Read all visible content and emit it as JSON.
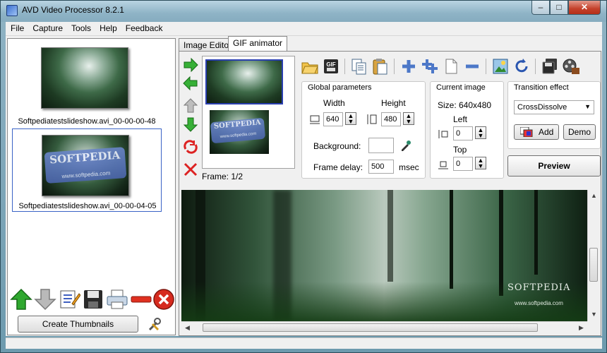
{
  "window": {
    "title": "AVD Video Processor 8.2.1"
  },
  "menu": [
    "File",
    "Capture",
    "Tools",
    "Help",
    "Feedback"
  ],
  "thumbnails": [
    {
      "label": "Softpediatestslideshow.avi_00-00-00-48"
    },
    {
      "label": "Softpediatestslideshow.avi_00-00-04-05",
      "banner": "SOFTPEDIA",
      "banner_sub": "www.softpedia.com"
    }
  ],
  "left_panel": {
    "create_thumbnails_label": "Create Thumbnails"
  },
  "tabs": [
    {
      "label": "Image Editor"
    },
    {
      "label": "GIF animator"
    }
  ],
  "frames": {
    "frame_label": "Frame: 1/2",
    "frame2_banner": "SOFTPEDIA",
    "frame2_sub": "www.softpedia.com"
  },
  "global_params": {
    "title": "Global parameters",
    "width_label": "Width",
    "height_label": "Height",
    "width_value": "640",
    "height_value": "480",
    "background_label": "Background:",
    "frame_delay_label": "Frame delay:",
    "frame_delay_value": "500",
    "frame_delay_unit": "msec"
  },
  "current_image": {
    "title": "Current image",
    "size_text": "Size: 640x480",
    "left_label": "Left",
    "left_value": "0",
    "top_label": "Top",
    "top_value": "0"
  },
  "transition": {
    "title": "Transition effect",
    "selected": "CrossDissolve",
    "add_label": "Add",
    "demo_label": "Demo"
  },
  "preview_button_label": "Preview",
  "preview": {
    "watermark": "SOFTPEDIA",
    "watermark_sub": "www.softpedia.com"
  },
  "colors": {
    "accent": "#2a3fb0",
    "title_bar": "#8eb3c6",
    "close": "#c4402a"
  }
}
